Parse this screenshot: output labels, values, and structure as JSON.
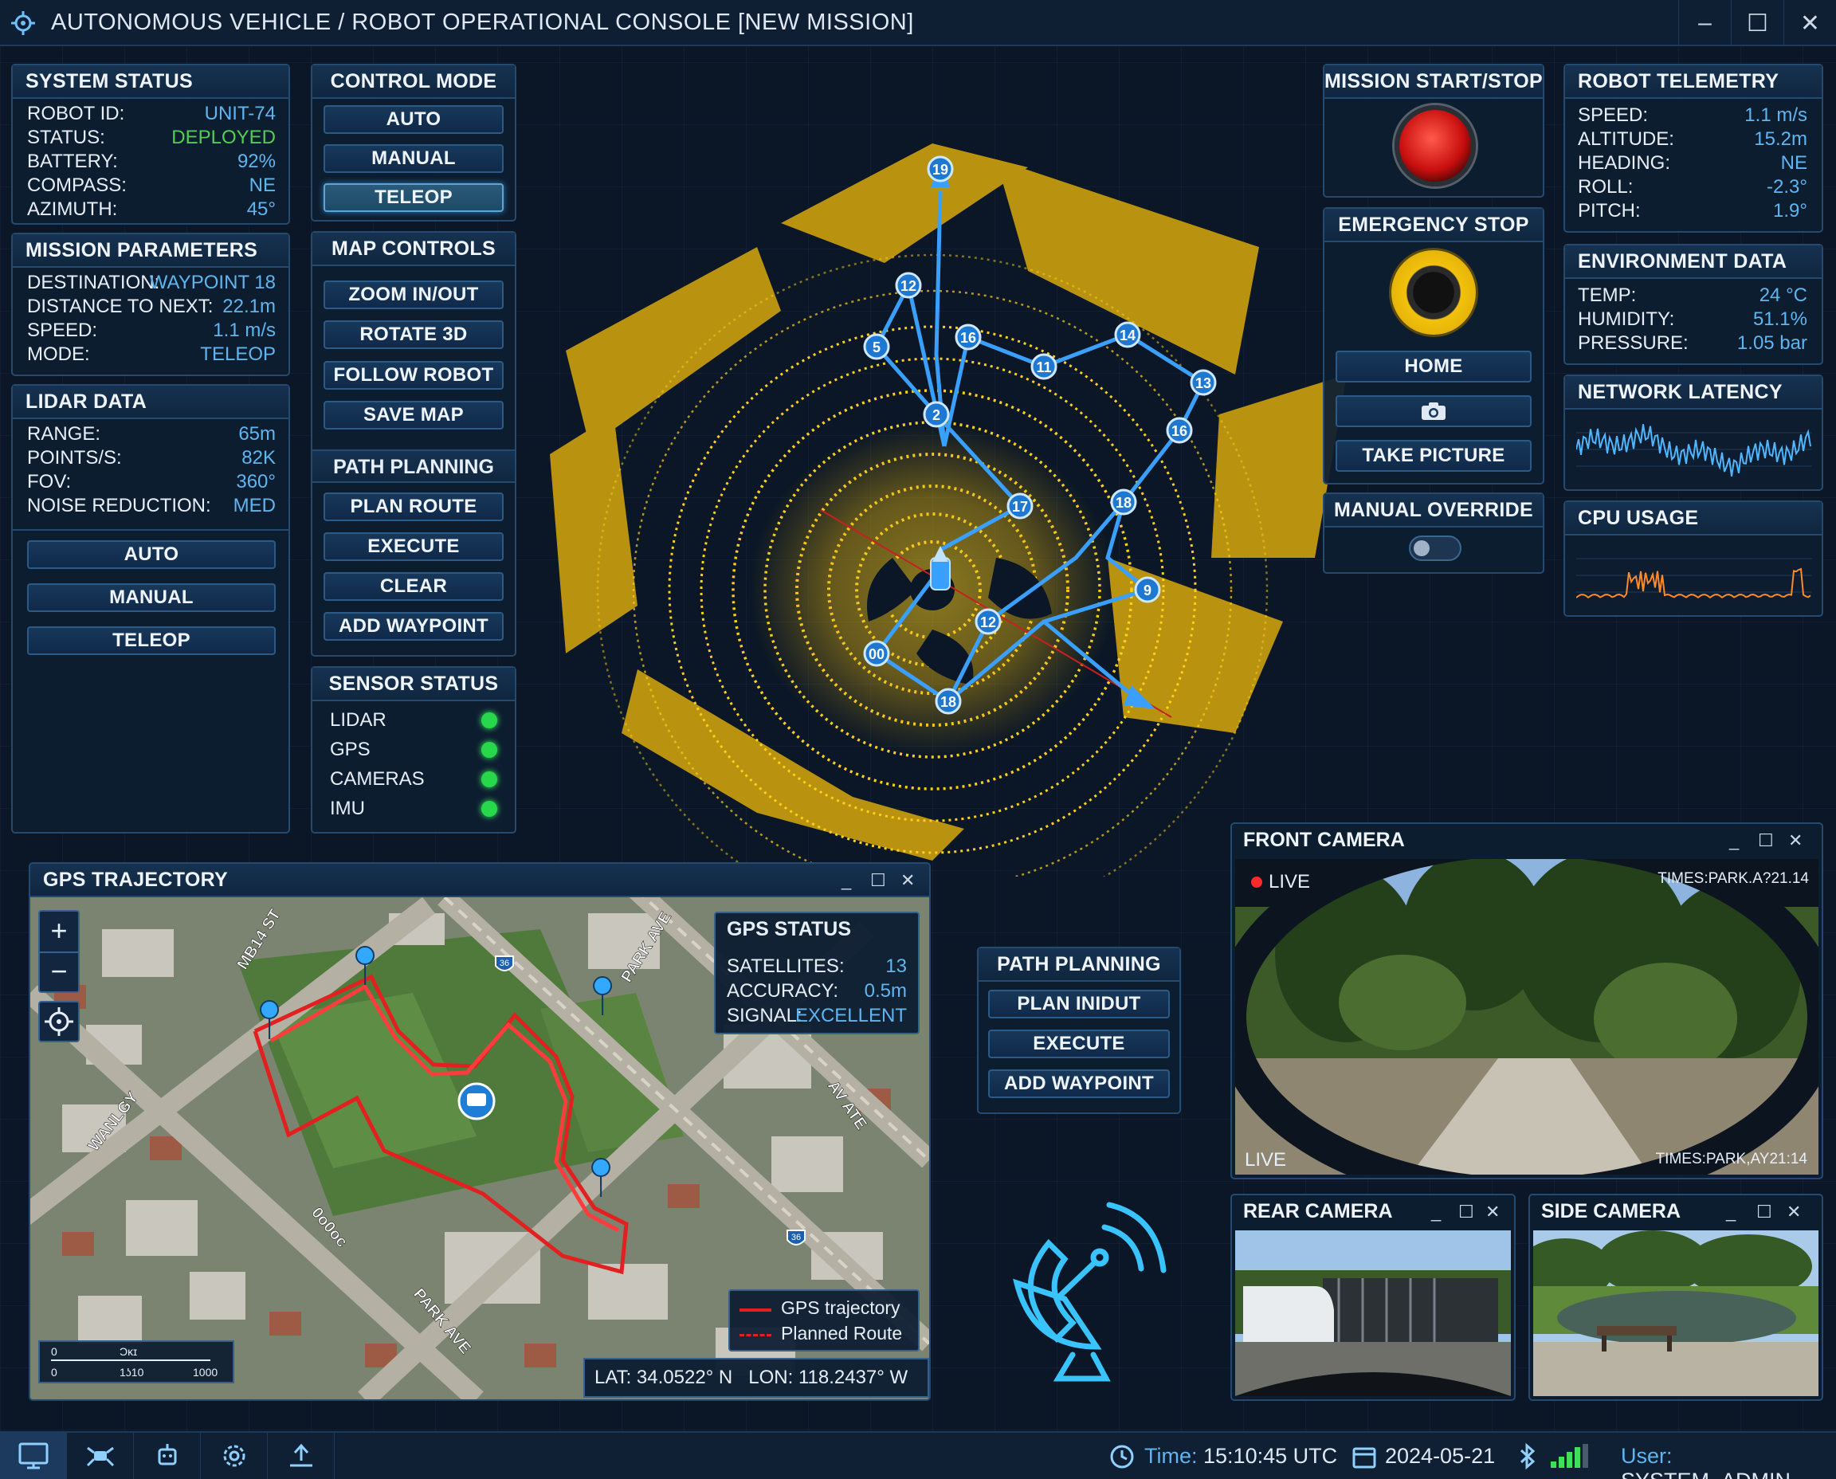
{
  "window": {
    "title": "AUTONOMOUS VEHICLE / ROBOT OPERATIONAL CONSOLE [NEW MISSION]"
  },
  "system_status": {
    "title": "SYSTEM STATUS",
    "rows": [
      {
        "k": "ROBOT ID:",
        "v": "UNIT-74"
      },
      {
        "k": "STATUS:",
        "v": "DEPLOYED"
      },
      {
        "k": "BATTERY:",
        "v": "92%"
      },
      {
        "k": "COMPASS:",
        "v": "NE"
      },
      {
        "k": "AZIMUTH:",
        "v": "45°"
      }
    ]
  },
  "mission_params": {
    "title": "MISSION PARAMETERS",
    "rows": [
      {
        "k": "DESTINATION:",
        "v": "WAYPOINT 18"
      },
      {
        "k": "DISTANCE TO NEXT:",
        "v": "22.1m"
      },
      {
        "k": "SPEED:",
        "v": "1.1 m/s"
      },
      {
        "k": "MODE:",
        "v": "TELEOP"
      }
    ]
  },
  "lidar": {
    "title": "LIDAR DATA",
    "rows": [
      {
        "k": "RANGE:",
        "v": "65m"
      },
      {
        "k": "POINTS/S:",
        "v": "82K"
      },
      {
        "k": "FOV:",
        "v": "360°"
      },
      {
        "k": "NOISE REDUCTION:",
        "v": "MED"
      }
    ],
    "buttons": [
      "AUTO",
      "MANUAL",
      "TELEOP"
    ]
  },
  "control_mode": {
    "title": "CONTROL MODE",
    "buttons": [
      "AUTO",
      "MANUAL",
      "TELEOP"
    ],
    "active": "TELEOP"
  },
  "map_controls": {
    "title": "MAP CONTROLS",
    "buttons": [
      "ZOOM IN/OUT",
      "ROTATE 3D",
      "FOLLOW ROBOT",
      "SAVE MAP"
    ]
  },
  "path_planning": {
    "title": "PATH PLANNING",
    "buttons": [
      "PLAN ROUTE",
      "EXECUTE",
      "CLEAR",
      "ADD WAYPOINT"
    ]
  },
  "sensor_status": {
    "title": "SENSOR STATUS",
    "items": [
      "LIDAR",
      "GPS",
      "CAMERAS",
      "IMU"
    ],
    "color": "#27d84a"
  },
  "mission": {
    "title": "MISSION START/STOP"
  },
  "estop": {
    "title": "EMERGENCY STOP",
    "home": "HOME",
    "take_picture": "TAKE PICTURE"
  },
  "override": {
    "title": "MANUAL OVERRIDE"
  },
  "telemetry": {
    "title": "ROBOT TELEMETRY",
    "rows": [
      {
        "k": "SPEED:",
        "v": "1.1 m/s"
      },
      {
        "k": "ALTITUDE:",
        "v": "15.2m"
      },
      {
        "k": "HEADING:",
        "v": "NE"
      },
      {
        "k": "ROLL:",
        "v": "-2.3°"
      },
      {
        "k": "PITCH:",
        "v": "1.9°"
      }
    ]
  },
  "environment": {
    "title": "ENVIRONMENT DATA",
    "rows": [
      {
        "k": "TEMP:",
        "v": "24 °C"
      },
      {
        "k": "HUMIDITY:",
        "v": "51.1%"
      },
      {
        "k": "PRESSURE:",
        "v": "1.05 bar"
      }
    ]
  },
  "network": {
    "title": "NETWORK LATENCY"
  },
  "cpu": {
    "title": "CPU USAGE"
  },
  "waypoints": [
    "19",
    "12",
    "16",
    "14",
    "5",
    "11",
    "13",
    "2",
    "16",
    "17",
    "18",
    "9",
    "12",
    "00",
    "18"
  ],
  "gps": {
    "title": "GPS TRAJECTORY",
    "status": {
      "title": "GPS STATUS",
      "rows": [
        {
          "k": "SATELLITES:",
          "v": "13"
        },
        {
          "k": "ACCURACY:",
          "v": "0.5m"
        },
        {
          "k": "SIGNAL:",
          "v": "EXCELLENT"
        }
      ]
    },
    "streets": [
      "MB14 ST",
      "PARK AVE",
      "WANLGY",
      "PARK AVE",
      "0o0oc",
      "AV ATE"
    ],
    "legend": {
      "traj": "GPS trajectory",
      "plan": "Planned Route"
    },
    "coords": "LAT: 34.0522° N   LON: 118.2437° W",
    "scale": {
      "top": "0",
      "top_mid": "Ɔĸɪ",
      "bot": "0",
      "bot_mid": "1ʖ10",
      "bot_end": "1000"
    },
    "shields": [
      "36",
      "36"
    ]
  },
  "path_planning2": {
    "title": "PATH PLANNING",
    "buttons": [
      "PLAN INIDUT",
      "EXECUTE",
      "ADD WAYPOINT"
    ]
  },
  "front_cam": {
    "title": "FRONT CAMERA",
    "live": "LIVE",
    "live2": "LIVE",
    "ts1": "TIMES:PARK.A?21.14",
    "ts2": "TIMES:PARK,AY21:14"
  },
  "rear_cam": {
    "title": "REAR CAMERA"
  },
  "side_cam": {
    "title": "SIDE CAMERA"
  },
  "status_bar": {
    "time_label": "Time:",
    "time": "15:10:45 UTC",
    "date": "2024-05-21",
    "user_label": "User:",
    "user": "SYSTEM_ADMIN"
  }
}
